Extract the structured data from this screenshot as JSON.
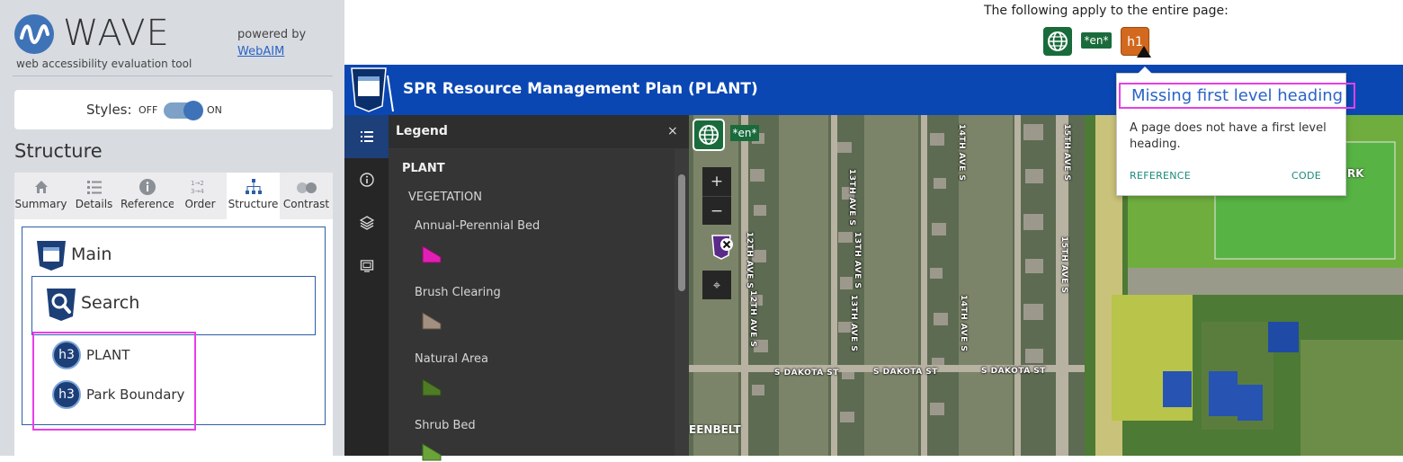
{
  "wave": {
    "title": "WAVE",
    "subtitle": "web accessibility evaluation tool",
    "powered_by": "powered by",
    "webaim_link": "WebAIM",
    "styles_label": "Styles:",
    "styles_off": "OFF",
    "styles_on": "ON",
    "structure_heading": "Structure",
    "tabs": [
      {
        "label": "Summary",
        "icon": "home-icon"
      },
      {
        "label": "Details",
        "icon": "list-icon"
      },
      {
        "label": "Reference",
        "icon": "info-icon"
      },
      {
        "label": "Order",
        "icon": "order-icon"
      },
      {
        "label": "Structure",
        "icon": "structure-icon",
        "active": true
      },
      {
        "label": "Contrast",
        "icon": "contrast-icon"
      }
    ],
    "structure": {
      "main_label": "Main",
      "search_label": "Search",
      "headings": [
        {
          "level": "h3",
          "text": "PLANT"
        },
        {
          "level": "h3",
          "text": "Park Boundary"
        }
      ]
    }
  },
  "page_notice": "The following apply to the entire page:",
  "page_icons": {
    "lang_en": "*en*",
    "h1_alert": "h1"
  },
  "app": {
    "title": "SPR Resource Management Plan (PLANT)"
  },
  "legend": {
    "title": "Legend",
    "close": "×",
    "group": "PLANT",
    "sublayer": "VEGETATION",
    "items": [
      {
        "label": "Annual-Perennial Bed",
        "color": "#e21fb4"
      },
      {
        "label": "Brush Clearing",
        "color": "#a28f7f"
      },
      {
        "label": "Natural Area",
        "color": "#4f7a26"
      },
      {
        "label": "Shrub Bed",
        "color": "#6aa33a"
      }
    ]
  },
  "map": {
    "lang_en": "*en*",
    "zoom_in": "+",
    "zoom_out": "−",
    "locate": "⌖",
    "street_labels": [
      "12TH AVE S",
      "13TH AVE S",
      "13TH AVE S",
      "12TH AVE S",
      "13TH AVE S",
      "14TH AVE S",
      "14TH AVE S",
      "15TH AVE S",
      "15TH AVE S",
      "S DAKOTA ST",
      "S DAKOTA ST",
      "S DAKOTA ST"
    ],
    "fields_label": "RK",
    "greenbelt_label": "EENBELT"
  },
  "popup": {
    "title": "Missing first level heading",
    "text": "A page does not have a first level heading.",
    "reference": "REFERENCE",
    "code": "CODE"
  },
  "colors": {
    "wave_blue": "#3f73b8",
    "app_header": "#0a47b3",
    "lang_green": "#1a6b3c",
    "h1_orange": "#d2691e",
    "highlight_magenta": "#e93ee9"
  }
}
